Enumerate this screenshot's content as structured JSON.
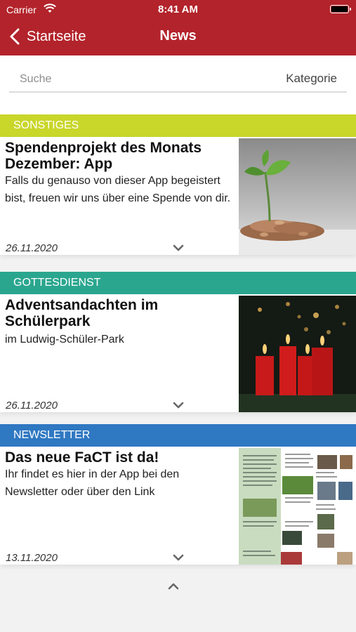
{
  "status": {
    "carrier": "Carrier",
    "time": "8:41 AM"
  },
  "nav": {
    "back_label": "Startseite",
    "title": "News"
  },
  "search": {
    "placeholder": "Suche",
    "category_label": "Kategorie"
  },
  "colors": {
    "header": "#b3232b",
    "sonstiges": "#c9d62a",
    "gottesdienst": "#2aa68f",
    "newsletter": "#2f78c2"
  },
  "cards": [
    {
      "category": "SONSTIGES",
      "title": "Spendenprojekt des Monats Dezember: App",
      "description": "Falls du genauso von dieser App begeistert bist, freuen wir uns über eine Spende von dir.",
      "date": "26.11.2020",
      "image": "plant-on-coins-image"
    },
    {
      "category": "GOTTESDIENST",
      "title": "Adventsandachten im Schülerpark",
      "description": "im Ludwig-Schüler-Park",
      "date": "26.11.2020",
      "image": "advent-candles-image"
    },
    {
      "category": "NEWSLETTER",
      "title": "Das neue FaCT ist da!",
      "description": "Ihr findet es hier in der App bei den Newsletter oder über den Link",
      "date": "13.11.2020",
      "image": "newsletter-page-image"
    }
  ],
  "icons": {
    "back": "chevron-left-icon",
    "expand": "chevron-down-icon",
    "scroll_top": "chevron-up-icon"
  }
}
